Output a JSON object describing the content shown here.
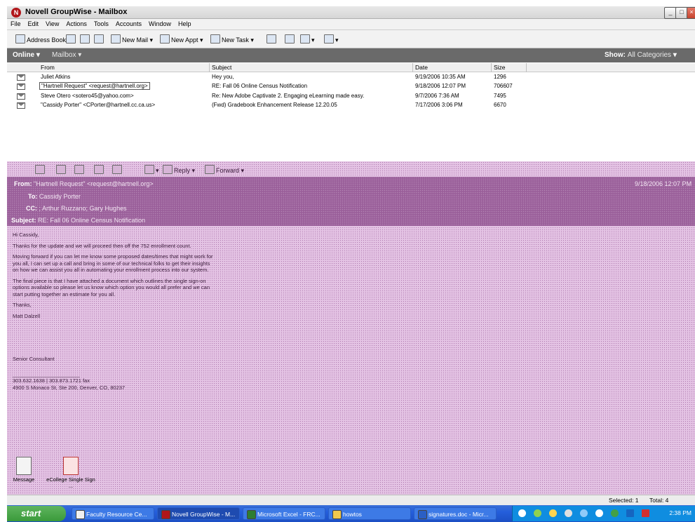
{
  "window": {
    "title": "Novell GroupWise - Mailbox",
    "min": "_",
    "max": "□",
    "close": "×"
  },
  "menu": [
    "File",
    "Edit",
    "View",
    "Actions",
    "Tools",
    "Accounts",
    "Window",
    "Help"
  ],
  "toolbar": {
    "address_book": "Address Book",
    "new_mail": "New Mail",
    "new_appt": "New Appt",
    "new_task": "New Task"
  },
  "modebar": {
    "online": "Online",
    "mailbox": "Mailbox",
    "show_label": "Show:",
    "show_value": "All Categories"
  },
  "list": {
    "columns": [
      "From",
      "Subject",
      "Date",
      "Size"
    ],
    "rows": [
      {
        "from": "Juliet Atkins",
        "subject": "Hey you,",
        "date": "9/19/2006 10:35 AM",
        "size": "1296"
      },
      {
        "from": "\"Hartnell Request\" <request@hartnell.org>",
        "subject": "RE: Fall 06 Online Census Notification",
        "date": "9/18/2006 12:07 PM",
        "size": "706607"
      },
      {
        "from": "Steve Otero <sotero45@yahoo.com>",
        "subject": "Re: New Adobe Captivate 2. Engaging eLearning made easy.",
        "date": "9/7/2006 7:36 AM",
        "size": "7495"
      },
      {
        "from": "\"Cassidy Porter\" <CPorter@hartnell.cc.ca.us>",
        "subject": "(Fwd) Gradebook Enhancement Release 12.20.05",
        "date": "7/17/2006 3:06 PM",
        "size": "6670"
      }
    ]
  },
  "reader": {
    "reply": "Reply",
    "forward": "Forward",
    "from_label": "From:",
    "from": "\"Hartnell Request\" <request@hartnell.org>",
    "date": "9/18/2006 12:07 PM",
    "to_label": "To:",
    "to": "Cassidy Porter",
    "cc_label": "CC:",
    "cc": "; Arthur Ruzzano; Gary Hughes",
    "subject_label": "Subject:",
    "subject": "RE: Fall 06 Online Census Notification",
    "body": [
      "Hi Cassidy,",
      "Thanks for the update and we will proceed then off the 752 enrollment count.",
      "Moving forward if you can let me know some proposed dates/times that might work for you all, I can set up a call and bring in some of our technical folks to get their insights on how we can assist you all in automating your enrollment process into our system.",
      "The final piece is that I have attached a document which outlines the single sign-on options available so please let us know which option you would all prefer and we can start putting together an estimate for you all.",
      "Thanks,",
      "Matt Dalzell"
    ],
    "title": "Senior Consultant",
    "sig_rule": "_______________________",
    "phone": "303.632.1638 | 303.873.1721 fax",
    "address": "4900 S Monaco St, Ste 200, Denver, CO, 80237",
    "attachments": [
      {
        "name": "Message"
      },
      {
        "name": "eCollege Single Sign ..."
      }
    ]
  },
  "status": {
    "selected": "Selected: 1",
    "total": "Total: 4"
  },
  "taskbar": {
    "start": "start",
    "tasks": [
      "Faculty Resource Ce...",
      "Novell GroupWise - M...",
      "Microsoft Excel - FRC...",
      "howtos",
      "signatures.doc - Micr..."
    ],
    "clock": "2:38 PM"
  },
  "colors": {
    "reading_pane": "#e4c3e4",
    "header_band": "#9a5f9a",
    "taskbar": "#245edb"
  }
}
